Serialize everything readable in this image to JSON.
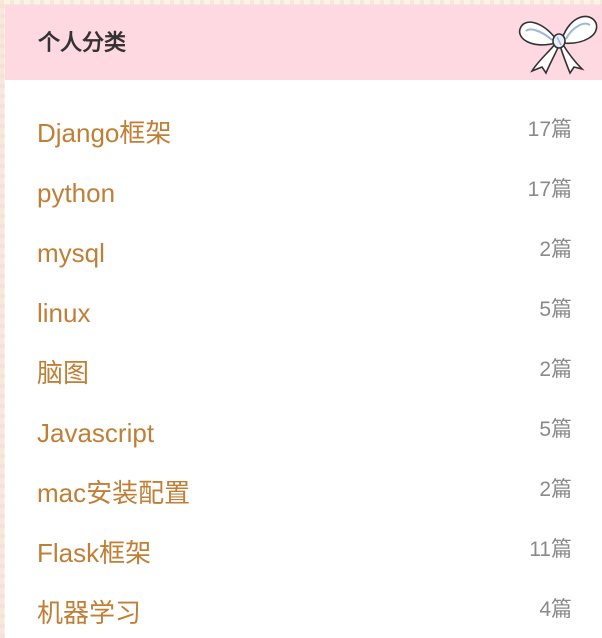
{
  "panel": {
    "title": "个人分类",
    "decoration_icon": "bow-icon"
  },
  "categories": [
    {
      "name": "Django框架",
      "count": "17篇"
    },
    {
      "name": "python",
      "count": "17篇"
    },
    {
      "name": "mysql",
      "count": "2篇"
    },
    {
      "name": "linux",
      "count": "5篇"
    },
    {
      "name": "脑图",
      "count": "2篇"
    },
    {
      "name": "Javascript",
      "count": "5篇"
    },
    {
      "name": "mac安装配置",
      "count": "2篇"
    },
    {
      "name": "Flask框架",
      "count": "11篇"
    },
    {
      "name": "机器学习",
      "count": "4篇"
    }
  ],
  "colors": {
    "header_bg": "#ffd9e2",
    "link": "#c07f36",
    "count": "#8a8a8a",
    "title": "#333333"
  }
}
